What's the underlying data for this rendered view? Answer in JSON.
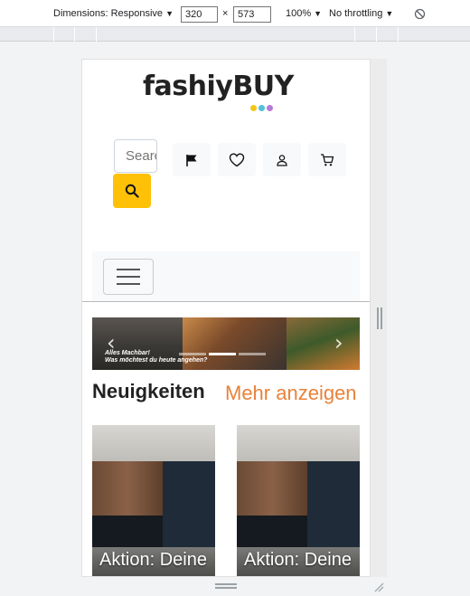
{
  "devtools": {
    "dimensions_label": "Dimensions: Responsive",
    "width_value": "320",
    "times_sign": "×",
    "height_value": "573",
    "zoom_label": "100%",
    "throttling_label": "No throttling"
  },
  "site": {
    "logo_text": "fashiyBUY",
    "logo_dot_colors": [
      "#f5c518",
      "#4fc3d9",
      "#b57bd8"
    ],
    "search": {
      "placeholder": "Search"
    },
    "accent_color": "#ffc107",
    "icons": [
      "flag-icon",
      "heart-icon",
      "user-icon",
      "cart-icon"
    ]
  },
  "carousel": {
    "banner_text_line1": "Alles Machbar!",
    "banner_text_line2": "Was möchtest du heute angehen?",
    "prev_label": "‹",
    "next_label": "›",
    "active_slide": 2,
    "slide_count": 3
  },
  "news": {
    "title": "Neuigkeiten",
    "more_link": "Mehr anzeigen",
    "more_link_color": "#e8823a",
    "cards": [
      {
        "caption": "Aktion: Deine"
      },
      {
        "caption": "Aktion: Deine"
      }
    ]
  }
}
